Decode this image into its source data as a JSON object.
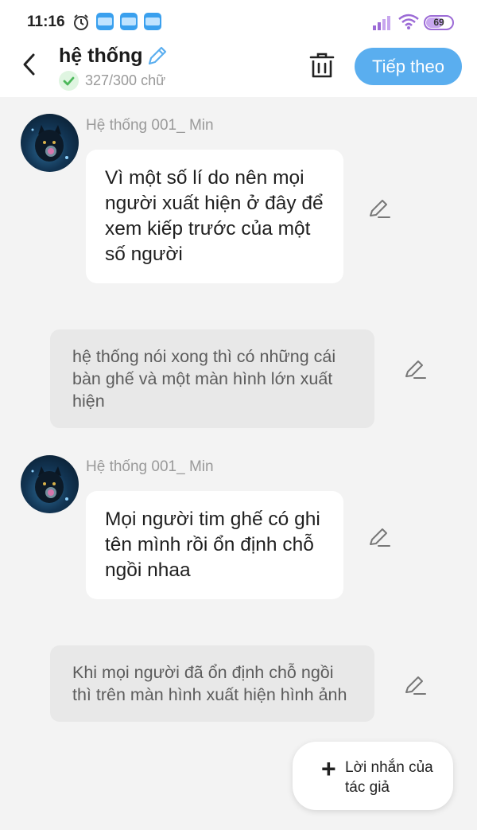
{
  "status_bar": {
    "time": "11:16",
    "battery": "69",
    "app_icons": [
      "NOVEL TOON",
      "NOVEL TOON",
      "NOVEL TOON"
    ],
    "icons": [
      "alarm-icon",
      "signal-icon",
      "wifi-icon",
      "battery-icon"
    ]
  },
  "header": {
    "title": "hệ thống",
    "word_count": "327/300 chữ",
    "next_label": "Tiếp theo",
    "icons": [
      "back-arrow-icon",
      "pencil-icon",
      "check-icon",
      "trash-icon"
    ]
  },
  "messages": [
    {
      "type": "character",
      "sender": "Hệ thống 001_ Min",
      "text": "Vì một số lí do nên mọi người xuất hiện ở đây để xem kiếp trước của một số người"
    },
    {
      "type": "narration",
      "text": "hệ thống nói xong thì có những cái bàn ghế và một màn hình lớn xuất hiện"
    },
    {
      "type": "character",
      "sender": "Hệ thống 001_ Min",
      "text": "Mọi người tim ghế có ghi tên mình rồi ổn định chỗ ngồi nhaa"
    },
    {
      "type": "narration",
      "text": "Khi mọi người đã ổn định chỗ ngồi thì trên màn hình xuất hiện hình ảnh"
    }
  ],
  "author_note": {
    "label": "Lời nhắn của tác giả"
  },
  "colors": {
    "accent": "#5aaeef",
    "background": "#f3f3f3",
    "narration_bg": "#e8e8e8",
    "check": "#4cb85a"
  }
}
